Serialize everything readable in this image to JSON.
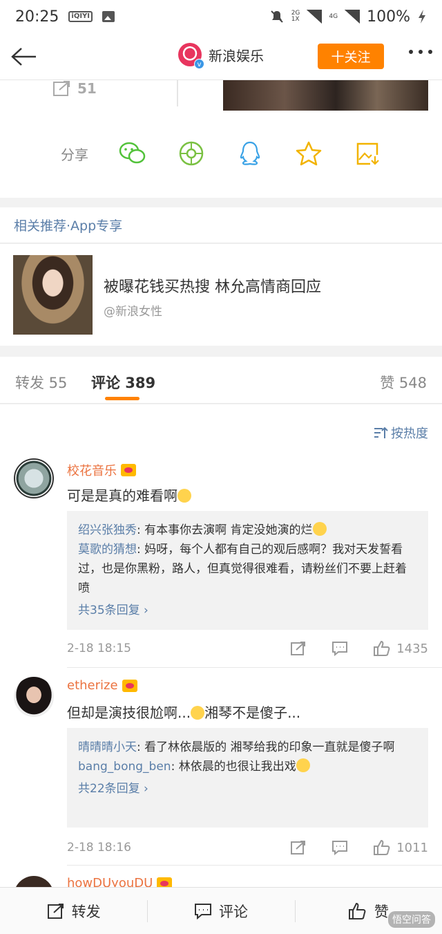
{
  "status_bar": {
    "time": "20:25",
    "app_icon": "iqiyi-icon",
    "battery": "100%",
    "network_small_top": "2G",
    "network_small_bottom": "1X",
    "network_4g": "4G"
  },
  "nav": {
    "title": "新浪娱乐",
    "follow_label": "十关注"
  },
  "post": {
    "repost_count": "51",
    "share_label": "分享"
  },
  "recommend": {
    "header": "相关推荐·App专享",
    "title": "被曝花钱买热搜 林允高情商回应",
    "source": "@新浪女性"
  },
  "tabs": {
    "repost": "转发 55",
    "comment": "评论 389",
    "like": "赞 548"
  },
  "sort_label": "按热度",
  "comments": [
    {
      "name": "校花音乐",
      "text": "可是是真的难看啊",
      "replies": [
        {
          "name": "绍兴张独秀",
          "text": ": 有本事你去演啊 肯定没她演的烂"
        },
        {
          "name": "莫歌的猜想",
          "text": ": 妈呀，每个人都有自己的观后感啊？我对天发誓看过，也是你黑粉，路人，但真觉得很难看，请粉丝们不要上赶着喷"
        }
      ],
      "more": "共35条回复",
      "time": "2-18 18:15",
      "likes": "1435"
    },
    {
      "name": "etherize",
      "text_a": "但却是演技很尬啊...",
      "text_b": "湘琴不是傻子...",
      "replies": [
        {
          "name": "晴晴晴小天",
          "text": ": 看了林依晨版的 湘琴给我的印象一直就是傻子啊"
        },
        {
          "name": "bang_bong_ben",
          "text": ": 林依晨的也很让我出戏"
        }
      ],
      "more": "共22条回复",
      "time": "2-18 18:16",
      "likes": "1011"
    },
    {
      "name": "howDUyouDU"
    }
  ],
  "bottom_bar": {
    "repost": "转发",
    "comment": "评论",
    "like": "赞"
  },
  "watermark": "悟空问答"
}
